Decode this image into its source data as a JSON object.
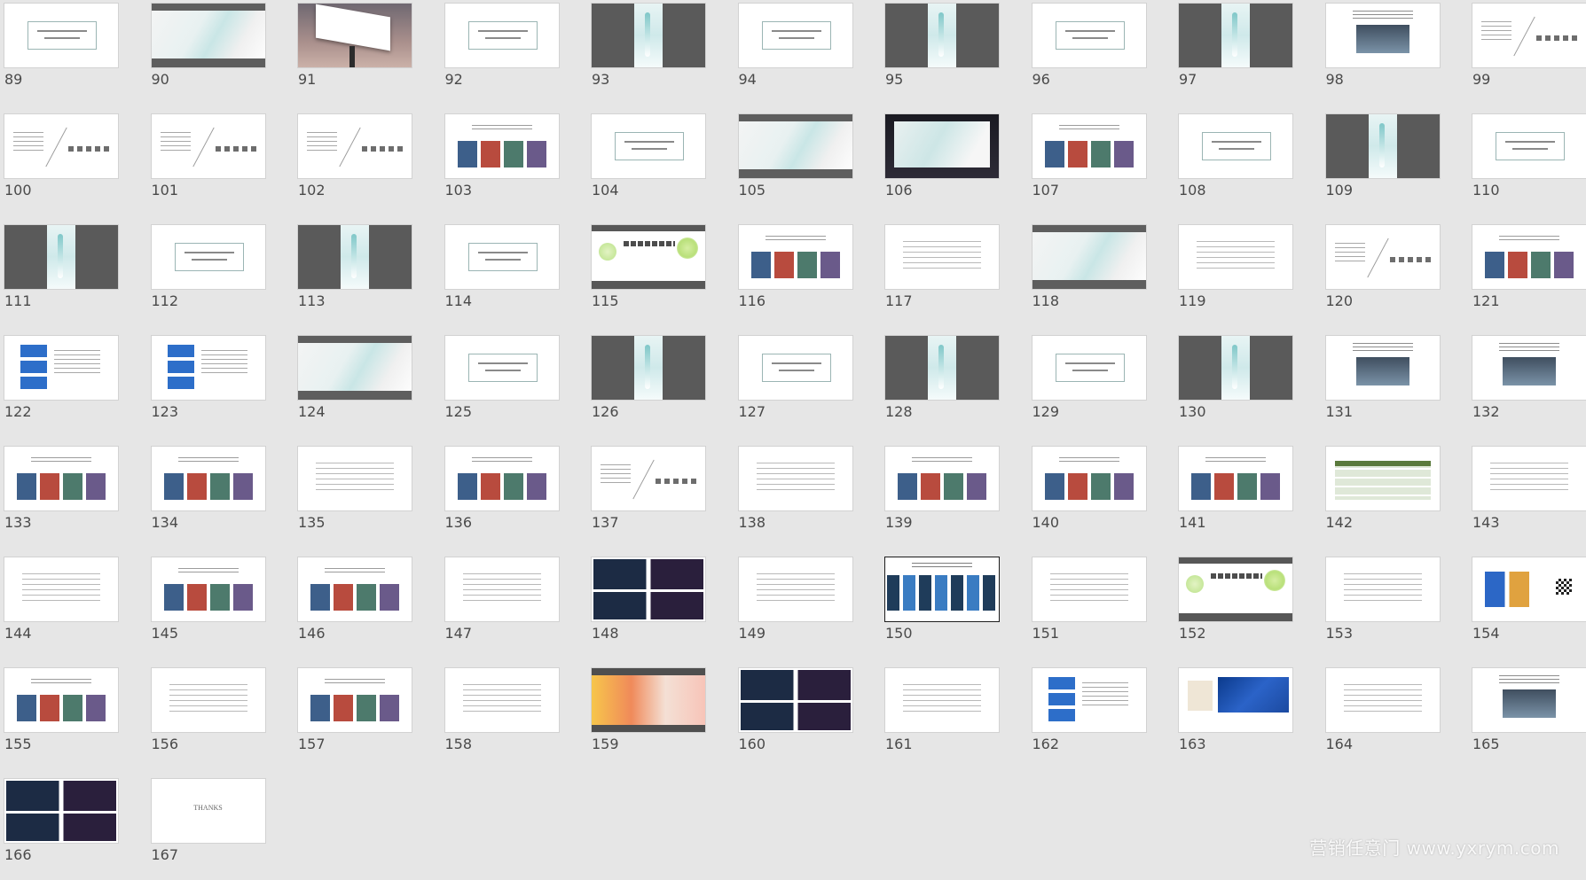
{
  "watermark": "营销任意门 www.yxrym.com",
  "thanks_text": "THANKS",
  "slides": [
    {
      "n": "89",
      "v": "frame"
    },
    {
      "n": "90",
      "v": "wave"
    },
    {
      "n": "91",
      "v": "billboard"
    },
    {
      "n": "92",
      "v": "frame"
    },
    {
      "n": "93",
      "v": "dark"
    },
    {
      "n": "94",
      "v": "frame"
    },
    {
      "n": "95",
      "v": "dark"
    },
    {
      "n": "96",
      "v": "frame"
    },
    {
      "n": "97",
      "v": "dark"
    },
    {
      "n": "98",
      "v": "room"
    },
    {
      "n": "99",
      "v": "split"
    },
    {
      "n": "100",
      "v": "split"
    },
    {
      "n": "101",
      "v": "split"
    },
    {
      "n": "102",
      "v": "split"
    },
    {
      "n": "103",
      "v": "photo"
    },
    {
      "n": "104",
      "v": "frame"
    },
    {
      "n": "105",
      "v": "wave"
    },
    {
      "n": "106",
      "v": "night"
    },
    {
      "n": "107",
      "v": "photo"
    },
    {
      "n": "108",
      "v": "frame"
    },
    {
      "n": "109",
      "v": "dark"
    },
    {
      "n": "110",
      "v": "frame"
    },
    {
      "n": "111",
      "v": "dark"
    },
    {
      "n": "112",
      "v": "frame"
    },
    {
      "n": "113",
      "v": "dark"
    },
    {
      "n": "114",
      "v": "frame"
    },
    {
      "n": "115",
      "v": "green"
    },
    {
      "n": "116",
      "v": "photo"
    },
    {
      "n": "117",
      "v": "text"
    },
    {
      "n": "118",
      "v": "wave"
    },
    {
      "n": "119",
      "v": "text"
    },
    {
      "n": "120",
      "v": "split"
    },
    {
      "n": "121",
      "v": "photo"
    },
    {
      "n": "122",
      "v": "blue"
    },
    {
      "n": "123",
      "v": "blue"
    },
    {
      "n": "124",
      "v": "wave"
    },
    {
      "n": "125",
      "v": "frame"
    },
    {
      "n": "126",
      "v": "dark"
    },
    {
      "n": "127",
      "v": "frame"
    },
    {
      "n": "128",
      "v": "dark"
    },
    {
      "n": "129",
      "v": "frame"
    },
    {
      "n": "130",
      "v": "dark"
    },
    {
      "n": "131",
      "v": "room"
    },
    {
      "n": "132",
      "v": "room"
    },
    {
      "n": "133",
      "v": "photo"
    },
    {
      "n": "134",
      "v": "photo"
    },
    {
      "n": "135",
      "v": "text"
    },
    {
      "n": "136",
      "v": "photo"
    },
    {
      "n": "137",
      "v": "split"
    },
    {
      "n": "138",
      "v": "text"
    },
    {
      "n": "139",
      "v": "photo"
    },
    {
      "n": "140",
      "v": "photo"
    },
    {
      "n": "141",
      "v": "photo"
    },
    {
      "n": "142",
      "v": "table"
    },
    {
      "n": "143",
      "v": "text"
    },
    {
      "n": "144",
      "v": "text"
    },
    {
      "n": "145",
      "v": "photo"
    },
    {
      "n": "146",
      "v": "photo"
    },
    {
      "n": "147",
      "v": "text"
    },
    {
      "n": "148",
      "v": "mosaic"
    },
    {
      "n": "149",
      "v": "text"
    },
    {
      "n": "150",
      "v": "ui"
    },
    {
      "n": "151",
      "v": "text"
    },
    {
      "n": "152",
      "v": "green"
    },
    {
      "n": "153",
      "v": "text"
    },
    {
      "n": "154",
      "v": "phone"
    },
    {
      "n": "155",
      "v": "photo"
    },
    {
      "n": "156",
      "v": "text"
    },
    {
      "n": "157",
      "v": "photo"
    },
    {
      "n": "158",
      "v": "text"
    },
    {
      "n": "159",
      "v": "warm"
    },
    {
      "n": "160",
      "v": "mosaic"
    },
    {
      "n": "161",
      "v": "text"
    },
    {
      "n": "162",
      "v": "blue"
    },
    {
      "n": "163",
      "v": "bluewide"
    },
    {
      "n": "164",
      "v": "text"
    },
    {
      "n": "165",
      "v": "room"
    },
    {
      "n": "166",
      "v": "mosaic"
    },
    {
      "n": "167",
      "v": "thanks"
    }
  ]
}
